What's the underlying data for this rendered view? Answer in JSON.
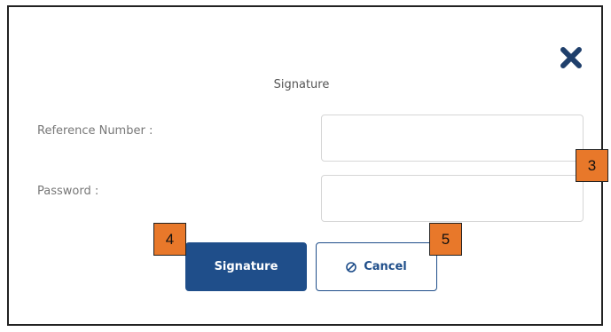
{
  "dialog": {
    "title": "Signature",
    "close_icon": "close-icon"
  },
  "form": {
    "reference_label": "Reference Number :",
    "reference_value": "",
    "password_label": "Password :",
    "password_value": ""
  },
  "actions": {
    "signature_label": "Signature",
    "cancel_label": "Cancel",
    "cancel_icon": "ban-icon"
  },
  "annotations": {
    "badge_3": "3",
    "badge_4": "4",
    "badge_5": "5",
    "badge_color": "#e8782a"
  },
  "colors": {
    "primary": "#1f4e8a",
    "border": "#d6d6d6",
    "text_muted": "#777777"
  }
}
